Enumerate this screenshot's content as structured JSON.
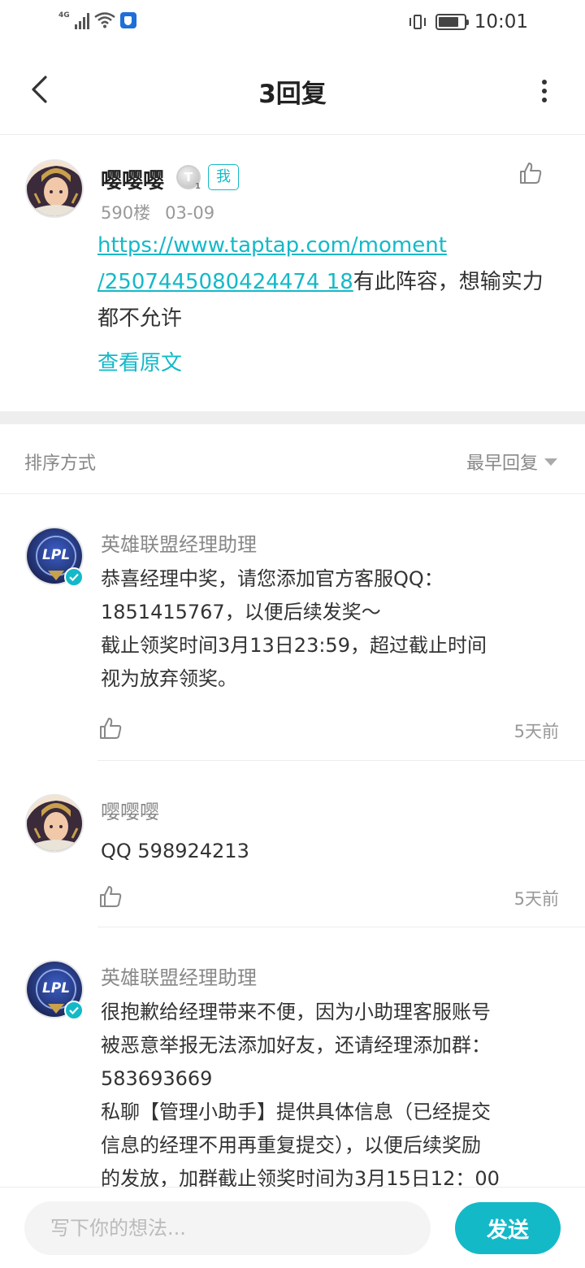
{
  "status_bar": {
    "network": "4G",
    "time": "10:01",
    "battery_level": 0.8
  },
  "header": {
    "title": "3回复"
  },
  "post": {
    "username": "嘤嘤嘤",
    "level": "T",
    "level_sub": "1",
    "me_tag": "我",
    "floor": "590楼",
    "date": "03-09",
    "link_line1": "https://www.taptap.com/moment",
    "link_line2": "/2507445080424474 18",
    "link_text": "https://www.taptap.com/moment/2507445080424474 18",
    "text_after_link": "有此阵容，想输实力都不允许",
    "view_original": "查看原文"
  },
  "sort": {
    "label": "排序方式",
    "value": "最早回复"
  },
  "replies": [
    {
      "author": "英雄联盟经理助理",
      "text": "恭喜经理中奖，请您添加官方客服QQ：\n1851415767，以便后续发奖～\n截止领奖时间3月13日23:59，超过截止时间\n视为放弃领奖。",
      "time": "5天前",
      "avatar": "lpl-logo-avatar",
      "verified": true
    },
    {
      "author": "嘤嘤嘤",
      "text": "QQ 598924213",
      "time": "5天前",
      "avatar": "anime-girl-avatar",
      "verified": false
    },
    {
      "author": "英雄联盟经理助理",
      "text": "很抱歉给经理带来不便，因为小助理客服账号\n被恶意举报无法添加好友，还请经理添加群：\n583693669\n私聊【管理小助手】提供具体信息（已经提交\n信息的经理不用再重复提交），以便后续奖励\n的发放，加群截止领奖时间为3月15日12：00",
      "time": "",
      "avatar": "lpl-logo-avatar",
      "verified": true
    }
  ],
  "input_bar": {
    "placeholder": "写下你的想法...",
    "send_label": "发送"
  },
  "colors": {
    "accent": "#14b9c8",
    "divider": "#eeeeee"
  }
}
